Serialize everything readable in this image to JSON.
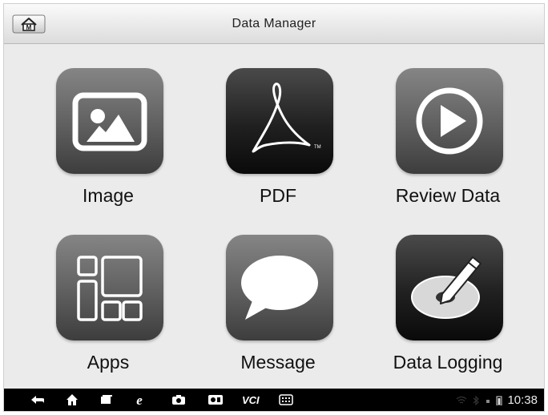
{
  "header": {
    "title": "Data Manager",
    "home_icon": "home-m-icon"
  },
  "tiles": [
    {
      "label": "Image",
      "icon": "image-icon"
    },
    {
      "label": "PDF",
      "icon": "pdf-icon"
    },
    {
      "label": "Review Data",
      "icon": "play-icon"
    },
    {
      "label": "Apps",
      "icon": "apps-grid-icon"
    },
    {
      "label": "Message",
      "icon": "speech-bubble-icon"
    },
    {
      "label": "Data Logging",
      "icon": "disc-pen-icon"
    }
  ],
  "navbar": {
    "icons": [
      "back-icon",
      "home-icon",
      "recent-apps-icon",
      "browser-icon",
      "camera-icon",
      "display-icon",
      "vci-icon",
      "menu-icon"
    ],
    "vci_label": "VCI",
    "clock": "10:38"
  }
}
